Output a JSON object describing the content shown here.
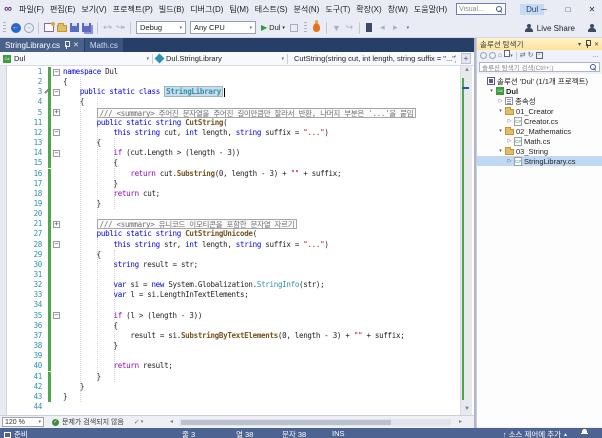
{
  "titlebar": {
    "menus": [
      "파일(F)",
      "편집(E)",
      "보기(V)",
      "프로젝트(P)",
      "빌드(B)",
      "디버그(D)",
      "팀(M)",
      "테스트(S)",
      "분석(N)",
      "도구(T)",
      "확장(X)",
      "창(W)",
      "도움말(H)"
    ],
    "search_placeholder": "Visual...",
    "solution_badge": "Dul"
  },
  "toolbar": {
    "config_dropdown": "Debug",
    "platform_dropdown": "Any CPU",
    "run_button": "Dul",
    "live_share": "Live Share"
  },
  "tabs": [
    {
      "label": "StringLibrary.cs",
      "active": true
    },
    {
      "label": "Math.cs",
      "active": false
    }
  ],
  "breadcrumb": {
    "project": "Dul",
    "type": "Dul.StringLibrary",
    "member": "CutString(string cut, int length, string suffix = \"...\")"
  },
  "editor": {
    "zoom_level": "120 %",
    "health_status": "문제가 검색되지 않음",
    "lines": [
      {
        "n": 1,
        "fold": "-",
        "ind": 0,
        "seg": [
          [
            "k",
            "namespace"
          ],
          [
            "p",
            " Dul"
          ]
        ]
      },
      {
        "n": 2,
        "ind": 0,
        "seg": [
          [
            "p",
            "{"
          ]
        ]
      },
      {
        "n": 3,
        "fold": "-",
        "ind": 4,
        "seg": [
          [
            "k",
            "public static class "
          ],
          [
            "hl",
            "StringLibrary"
          ]
        ],
        "pencil": true,
        "caret": true
      },
      {
        "n": 4,
        "ind": 4,
        "seg": [
          [
            "p",
            "{"
          ]
        ]
      },
      {
        "n": 5,
        "fold": "+",
        "ind": 8,
        "box": "/// <summary> 주어진 문자열을 주어진 길이만큼만 잘라서 반환, 나머지 부분은 '...'을 붙임"
      },
      {
        "n": 11,
        "ind": 8,
        "seg": [
          [
            "k",
            "public static string "
          ],
          [
            "m",
            "CutString"
          ],
          [
            "p",
            "("
          ]
        ]
      },
      {
        "n": 12,
        "fold": "-",
        "ind": 12,
        "seg": [
          [
            "k",
            "this string"
          ],
          [
            "p",
            " cut, "
          ],
          [
            "k",
            "int"
          ],
          [
            "p",
            " length, "
          ],
          [
            "k",
            "string"
          ],
          [
            "p",
            " suffix = "
          ],
          [
            "s",
            "\"...\""
          ],
          [
            "p",
            ")"
          ]
        ]
      },
      {
        "n": 13,
        "ind": 8,
        "seg": [
          [
            "p",
            "{"
          ]
        ]
      },
      {
        "n": 14,
        "fold": "-",
        "ind": 12,
        "seg": [
          [
            "c",
            "if"
          ],
          [
            "p",
            " (cut.Length > (length - 3))"
          ]
        ]
      },
      {
        "n": 15,
        "ind": 12,
        "seg": [
          [
            "p",
            "{"
          ]
        ]
      },
      {
        "n": 16,
        "ind": 16,
        "seg": [
          [
            "c",
            "return"
          ],
          [
            "p",
            " cut."
          ],
          [
            "m",
            "Substring"
          ],
          [
            "p",
            "(0, length - 3) + "
          ],
          [
            "s",
            "\"\""
          ],
          [
            "p",
            " + suffix;"
          ]
        ]
      },
      {
        "n": 17,
        "ind": 12,
        "seg": [
          [
            "p",
            "}"
          ]
        ]
      },
      {
        "n": 18,
        "ind": 12,
        "seg": [
          [
            "c",
            "return"
          ],
          [
            "p",
            " cut;"
          ]
        ]
      },
      {
        "n": 19,
        "ind": 8,
        "seg": [
          [
            "p",
            "}"
          ]
        ]
      },
      {
        "n": 20,
        "ind": 0,
        "seg": []
      },
      {
        "n": 21,
        "fold": "+",
        "ind": 8,
        "box": "/// <summary> 유니코드 이모티콘을 포함한 문자열 자르기"
      },
      {
        "n": 27,
        "ind": 8,
        "seg": [
          [
            "k",
            "public static string "
          ],
          [
            "m",
            "CutStringUnicode"
          ],
          [
            "p",
            "("
          ]
        ]
      },
      {
        "n": 28,
        "fold": "-",
        "ind": 12,
        "seg": [
          [
            "k",
            "this string"
          ],
          [
            "p",
            " str, "
          ],
          [
            "k",
            "int"
          ],
          [
            "p",
            " length, "
          ],
          [
            "k",
            "string"
          ],
          [
            "p",
            " suffix = "
          ],
          [
            "s",
            "\"...\""
          ],
          [
            "p",
            ")"
          ]
        ]
      },
      {
        "n": 29,
        "ind": 8,
        "seg": [
          [
            "p",
            "{"
          ]
        ]
      },
      {
        "n": 30,
        "ind": 12,
        "seg": [
          [
            "k",
            "string"
          ],
          [
            "p",
            " result = str;"
          ]
        ]
      },
      {
        "n": 31,
        "ind": 0,
        "seg": []
      },
      {
        "n": 32,
        "ind": 12,
        "seg": [
          [
            "k",
            "var"
          ],
          [
            "p",
            " si = "
          ],
          [
            "k",
            "new"
          ],
          [
            "p",
            " System.Globalization."
          ],
          [
            "t",
            "StringInfo"
          ],
          [
            "p",
            "(str);"
          ]
        ]
      },
      {
        "n": 33,
        "ind": 12,
        "seg": [
          [
            "k",
            "var"
          ],
          [
            "p",
            " l = si.LengthInTextElements;"
          ]
        ]
      },
      {
        "n": 34,
        "ind": 0,
        "seg": []
      },
      {
        "n": 35,
        "fold": "-",
        "ind": 12,
        "seg": [
          [
            "c",
            "if"
          ],
          [
            "p",
            " (l > (length - 3))"
          ]
        ]
      },
      {
        "n": 36,
        "ind": 12,
        "seg": [
          [
            "p",
            "{"
          ]
        ]
      },
      {
        "n": 37,
        "ind": 16,
        "seg": [
          [
            "p",
            "result = si."
          ],
          [
            "m",
            "SubstringByTextElements"
          ],
          [
            "p",
            "(0, length - 3) + "
          ],
          [
            "s",
            "\"\""
          ],
          [
            "p",
            " + suffix;"
          ]
        ]
      },
      {
        "n": 38,
        "ind": 12,
        "seg": [
          [
            "p",
            "}"
          ]
        ]
      },
      {
        "n": 39,
        "ind": 0,
        "seg": []
      },
      {
        "n": 40,
        "ind": 12,
        "seg": [
          [
            "c",
            "return"
          ],
          [
            "p",
            " result;"
          ]
        ]
      },
      {
        "n": 41,
        "ind": 8,
        "seg": [
          [
            "p",
            "}"
          ]
        ]
      },
      {
        "n": 42,
        "ind": 4,
        "seg": [
          [
            "p",
            "}"
          ]
        ]
      },
      {
        "n": 43,
        "ind": 0,
        "seg": [
          [
            "p",
            "}"
          ]
        ]
      },
      {
        "n": 44,
        "ind": 0,
        "seg": [],
        "nochange": true
      }
    ]
  },
  "solution_explorer": {
    "title": "솔루션 탐색기",
    "search_placeholder": "솔루션 탐색기 검색(Ctrl+;)",
    "tree": [
      {
        "label": "솔루션 'Dul' (1/1개 프로젝트)",
        "icon": "solution",
        "indent": 0
      },
      {
        "label": "Dul",
        "icon": "project",
        "indent": 1,
        "arrow": "expanded",
        "bold": true
      },
      {
        "label": "종속성",
        "icon": "dependencies",
        "indent": 2,
        "arrow": "collapsed"
      },
      {
        "label": "01_Creator",
        "icon": "folder",
        "indent": 2,
        "arrow": "expanded"
      },
      {
        "label": "Creator.cs",
        "icon": "csharp-file",
        "indent": 3,
        "arrow": "collapsed"
      },
      {
        "label": "02_Mathematics",
        "icon": "folder",
        "indent": 2,
        "arrow": "expanded"
      },
      {
        "label": "Math.cs",
        "icon": "csharp-file",
        "indent": 3,
        "arrow": "collapsed"
      },
      {
        "label": "03_String",
        "icon": "folder",
        "indent": 2,
        "arrow": "expanded"
      },
      {
        "label": "StringLibrary.cs",
        "icon": "csharp-file",
        "indent": 3,
        "arrow": "collapsed",
        "selected": true
      }
    ]
  },
  "status_bar": {
    "ready": "준비",
    "line": "줄 3",
    "column": "열 38",
    "character": "문자 38",
    "insert_mode": "INS",
    "source_control": "소스 제어에 추가"
  },
  "icons": {
    "logo": "∞",
    "minimize": "─",
    "maximize": "□",
    "close": "✕",
    "dropdown": "▾",
    "back": "←",
    "forward": "→",
    "undo": "↩",
    "redo": "↪",
    "play": "▶",
    "home": "⌂",
    "overflow": "…",
    "check": "✓",
    "up_arrow": "▲",
    "down_arrow": "▼",
    "left_arrow": "◂",
    "right_arrow": "▸",
    "collapsed": "▷",
    "expanded": "▾",
    "fold_open": "−",
    "fold_closed": "+",
    "split": "+",
    "upload": "↑",
    "sync": "⇄",
    "refresh": "↻"
  },
  "colors": {
    "status_bar": "#4D6391",
    "change_bar": "#4CA64C",
    "active_tool_header": "#FFE8A6",
    "tree_selection": "#BFD9F2",
    "keyword": "#0000E8",
    "control_keyword": "#8F08C4",
    "type": "#2B91AF",
    "method": "#74531F",
    "string": "#A31515",
    "line_number": "#2B91AF",
    "tab_strip": "#273F66",
    "active_tab": "#4A6189"
  }
}
